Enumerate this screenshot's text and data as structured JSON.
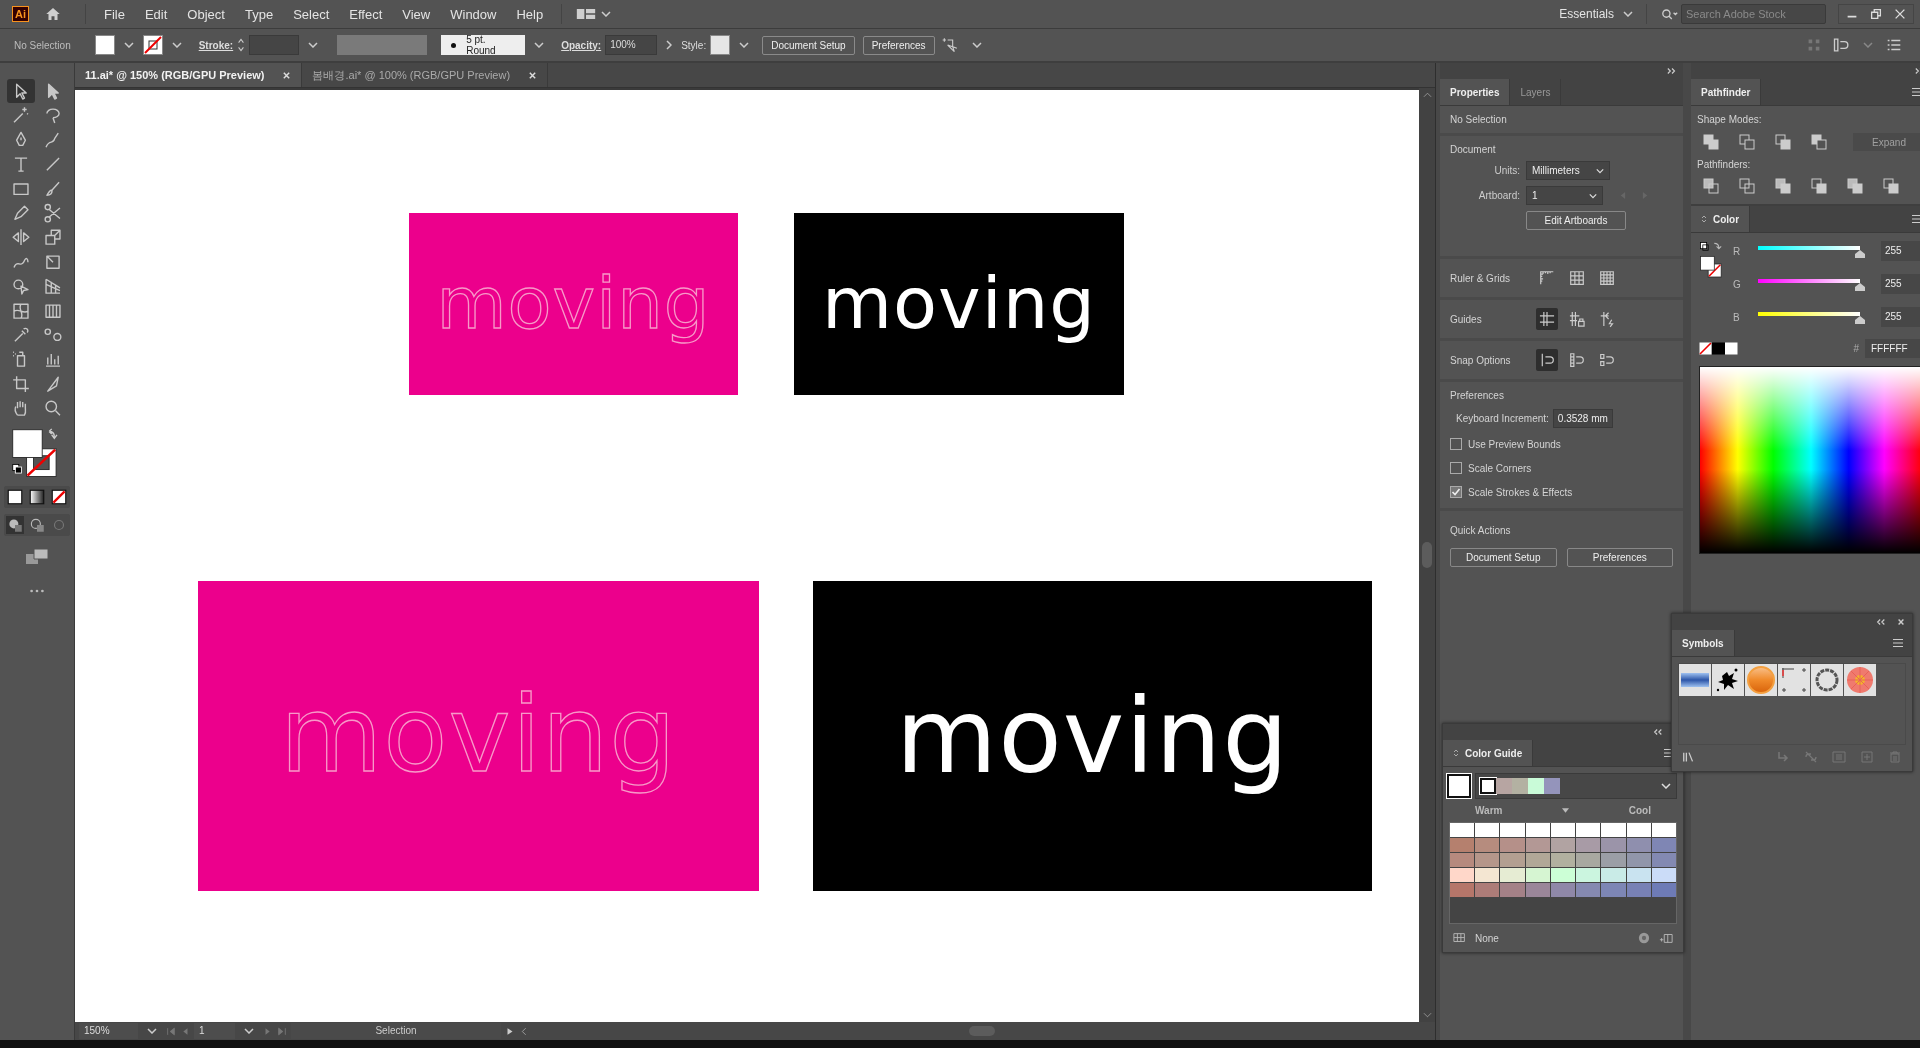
{
  "menu_bar": {
    "logo": "Ai",
    "menus": [
      "File",
      "Edit",
      "Object",
      "Type",
      "Select",
      "Effect",
      "View",
      "Window",
      "Help"
    ],
    "workspace": "Essentials",
    "search": {
      "placeholder": "Search Adobe Stock"
    }
  },
  "control_bar": {
    "selection": "No Selection",
    "stroke_label": "Stroke:",
    "brush": "5 pt. Round",
    "opacity_label": "Opacity:",
    "opacity": "100%",
    "style_label": "Style:",
    "buttons": [
      "Document Setup",
      "Preferences"
    ]
  },
  "document_tabs": [
    {
      "label": "11.ai* @ 150% (RGB/GPU Preview)",
      "selected": true
    },
    {
      "label": "봄배경.ai* @ 100% (RGB/GPU Preview)",
      "selected": false
    }
  ],
  "tools": [
    {
      "selected": true
    },
    {
      "selected": false
    },
    {
      "selected": false
    },
    {
      "selected": false
    },
    {
      "selected": false
    },
    {
      "selected": false
    },
    {
      "selected": false
    },
    {
      "selected": false
    },
    {
      "selected": false
    },
    {
      "selected": false
    },
    {
      "selected": false
    },
    {
      "selected": false
    },
    {
      "selected": false
    },
    {
      "selected": false
    },
    {
      "selected": false
    },
    {
      "selected": false
    },
    {
      "selected": false
    },
    {
      "selected": false
    },
    {
      "selected": false
    },
    {
      "selected": false
    },
    {
      "selected": false
    },
    {
      "selected": false
    },
    {
      "selected": false
    },
    {
      "selected": false
    },
    {
      "selected": false
    },
    {
      "selected": false
    },
    {
      "selected": false
    },
    {
      "selected": false
    }
  ],
  "artboards": [
    {
      "kind": "outline",
      "text": "moving",
      "color": "#ec008c"
    },
    {
      "kind": "solid",
      "text": "moving",
      "color": "#000000"
    },
    {
      "kind": "outline",
      "text": "moving",
      "color": "#ec008c"
    },
    {
      "kind": "solid",
      "text": "moving",
      "color": "#000000"
    }
  ],
  "status_bar": {
    "zoom": "150%",
    "artboard": "1",
    "tool": "Selection"
  },
  "properties": {
    "tabs": [
      {
        "label": "Properties",
        "selected": true
      },
      {
        "label": "Layers",
        "selected": false
      }
    ],
    "selection": "No Selection",
    "document": {
      "heading": "Document",
      "units_label": "Units:",
      "units": "Millimeters",
      "artboard_label": "Artboard:",
      "artboard": "1",
      "edit_button": "Edit Artboards"
    },
    "sections": [
      {
        "label": "Ruler & Grids",
        "buttons": [
          {
            "selected": false
          },
          {
            "selected": false
          },
          {
            "selected": false
          }
        ]
      },
      {
        "label": "Guides",
        "buttons": [
          {
            "selected": true
          },
          {
            "selected": false
          },
          {
            "selected": false
          }
        ]
      },
      {
        "label": "Snap Options",
        "buttons": [
          {
            "selected": true
          },
          {
            "selected": false
          },
          {
            "selected": false
          }
        ]
      }
    ],
    "preferences": {
      "heading": "Preferences",
      "keyboard_label": "Keyboard Increment:",
      "keyboard_value": "0.3528 mm",
      "checkboxes": [
        {
          "label": "Use Preview Bounds",
          "checked": false
        },
        {
          "label": "Scale Corners",
          "checked": false
        },
        {
          "label": "Scale Strokes & Effects",
          "checked": true
        }
      ]
    },
    "quick_actions": {
      "heading": "Quick Actions",
      "buttons": [
        "Document Setup",
        "Preferences"
      ]
    }
  },
  "pathfinder": {
    "title": "Pathfinder",
    "shape_modes_label": "Shape Modes:",
    "expand_button": "Expand",
    "expand_disabled": true,
    "pathfinders_label": "Pathfinders:"
  },
  "color": {
    "title": "Color",
    "channels": [
      {
        "label": "R",
        "value": "255",
        "level": 1
      },
      {
        "label": "G",
        "value": "255",
        "level": 1
      },
      {
        "label": "B",
        "value": "255",
        "level": 1
      }
    ],
    "hex_label": "#",
    "hex": "FFFFFF"
  },
  "symbols": {
    "title": "Symbols"
  },
  "color_guide": {
    "title": "Color Guide",
    "harmony": [
      {
        "color": "#ffffff"
      },
      {
        "color": "#b7a5a2"
      },
      {
        "color": "#b3b1a2"
      },
      {
        "color": "#c9fbd8"
      },
      {
        "color": "#9494bb"
      }
    ],
    "warm_label": "Warm",
    "cool_label": "Cool",
    "grid": [
      [
        {
          "color": "#ffffff"
        },
        {
          "color": "#ffffff"
        },
        {
          "color": "#ffffff"
        },
        {
          "color": "#ffffff"
        },
        {
          "color": "#ffffff"
        },
        {
          "color": "#ffffff"
        },
        {
          "color": "#ffffff"
        },
        {
          "color": "#ffffff"
        },
        {
          "color": "#ffffff"
        }
      ],
      [
        {
          "color": "#b5806e"
        },
        {
          "color": "#b68c7e"
        },
        {
          "color": "#b59089"
        },
        {
          "color": "#b39895"
        },
        {
          "color": "#b1a3a2"
        },
        {
          "color": "#a89ba6"
        },
        {
          "color": "#9b94a9"
        },
        {
          "color": "#8f8fae"
        },
        {
          "color": "#7f86b4"
        }
      ],
      [
        {
          "color": "#b68a7e"
        },
        {
          "color": "#b5968a"
        },
        {
          "color": "#b39f91"
        },
        {
          "color": "#b1a797"
        },
        {
          "color": "#b1b09f"
        },
        {
          "color": "#a8a8a0"
        },
        {
          "color": "#9b9ea6"
        },
        {
          "color": "#9196aa"
        },
        {
          "color": "#8389b2"
        }
      ],
      [
        {
          "color": "#ffd7c9"
        },
        {
          "color": "#f4e6d2"
        },
        {
          "color": "#e6ecd3"
        },
        {
          "color": "#d6f5d2"
        },
        {
          "color": "#ccffd6"
        },
        {
          "color": "#cbf5df"
        },
        {
          "color": "#c9ebe7"
        },
        {
          "color": "#c9e3f0"
        },
        {
          "color": "#cbdcf8"
        }
      ],
      [
        {
          "color": "#b5766a"
        },
        {
          "color": "#ad7c78"
        },
        {
          "color": "#a48187"
        },
        {
          "color": "#9a8699"
        },
        {
          "color": "#8f88a8"
        },
        {
          "color": "#8589b0"
        },
        {
          "color": "#7d86b5"
        },
        {
          "color": "#7881b5"
        },
        {
          "color": "#6e7bb6"
        }
      ]
    ],
    "footer": "None"
  }
}
